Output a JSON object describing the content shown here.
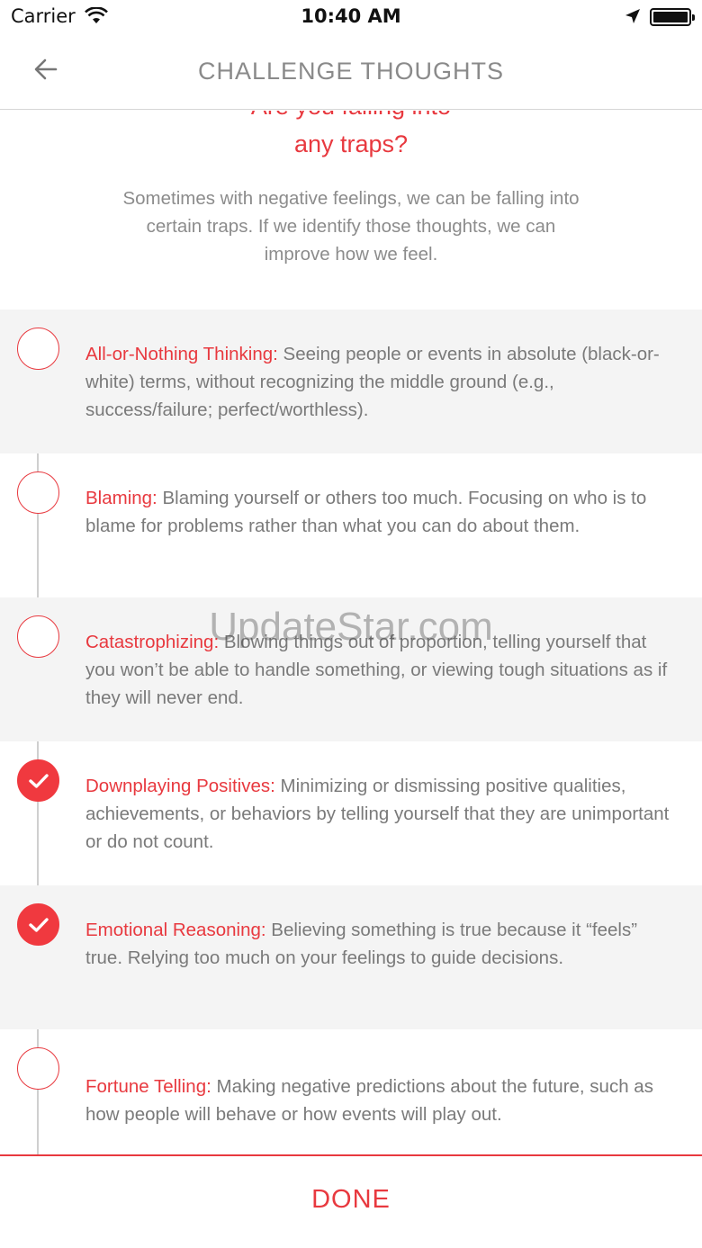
{
  "status": {
    "carrier": "Carrier",
    "time": "10:40 AM",
    "wifi_icon": "wifi-icon",
    "location_icon": "location-arrow-icon",
    "battery_icon": "battery-icon"
  },
  "nav": {
    "title": "CHALLENGE THOUGHTS",
    "back_icon": "back-arrow-icon"
  },
  "content": {
    "heading_line1": "Are you falling into",
    "heading_line2": "any traps?",
    "intro": "Sometimes with negative feelings, we can be falling into certain traps. If we identify those thoughts, we can improve how we feel."
  },
  "traps": [
    {
      "term": "All-or-Nothing Thinking:",
      "description": " Seeing people or events in absolute (black-or-white) terms, without recognizing the middle ground (e.g., success/failure; perfect/worthless).",
      "checked": false
    },
    {
      "term": "Blaming:",
      "description": " Blaming yourself or others too much. Focusing on who is to blame for problems rather than what you can do about them.",
      "checked": false
    },
    {
      "term": "Catastrophizing:",
      "description": " Blowing things out of proportion, telling yourself that you won’t be able to handle something, or viewing tough situations as if they will never end.",
      "checked": false
    },
    {
      "term": "Downplaying Positives:",
      "description": " Minimizing or dismissing positive qualities, achievements, or behaviors by telling yourself that they are unimportant or do not count.",
      "checked": true
    },
    {
      "term": "Emotional Reasoning:",
      "description": " Believing something is true because it “feels” true. Relying too much on your feelings to guide decisions.",
      "checked": true
    },
    {
      "term": "Fortune Telling:",
      "description": " Making negative predictions about the future, such as how people will behave or how events will play out.",
      "checked": false
    }
  ],
  "footer": {
    "done_label": "DONE"
  },
  "watermark": "UpdateStar.com",
  "colors": {
    "accent": "#e8393f",
    "shaded_row": "#f4f4f4",
    "body_text": "#7a7a7a"
  }
}
